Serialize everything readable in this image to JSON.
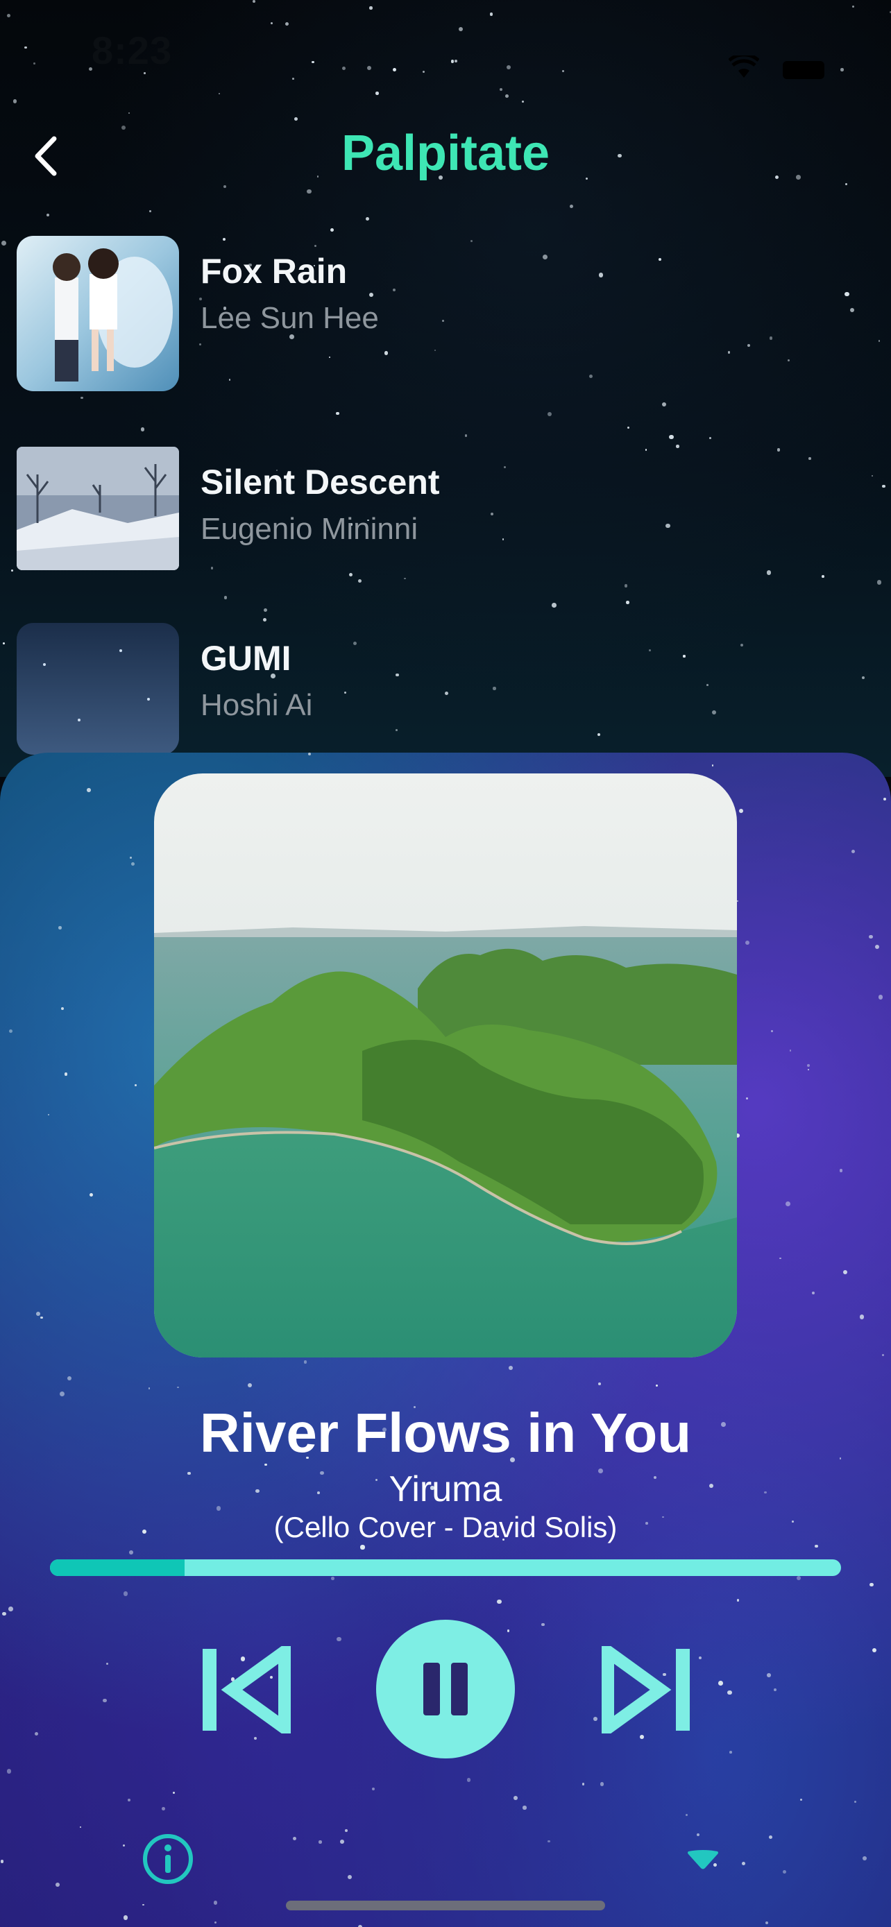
{
  "status_bar": {
    "time": "8:23"
  },
  "header": {
    "title": "Palpitate",
    "back_icon": "chevron-left-icon"
  },
  "tracks": [
    {
      "name": "Fox Rain",
      "artist": "Lee Sun Hee"
    },
    {
      "name": "Silent Descent",
      "artist": "Eugenio Mininni"
    },
    {
      "name": "GUMI",
      "artist": "Hoshi Ai"
    }
  ],
  "player": {
    "song_title": "River Flows in You",
    "artist": "Yiruma",
    "subtitle": "(Cello Cover - David Solis)",
    "progress_fraction": 0.17,
    "controls": {
      "prev_icon": "skip-previous-icon",
      "play_pause_icon": "pause-icon",
      "next_icon": "skip-next-icon"
    },
    "info_icon": "info-icon",
    "collapse_icon": "chevron-down-icon"
  },
  "colors": {
    "accent": "#3ee6b4",
    "control": "#7eeee4",
    "progress_fill": "#0fc6b6",
    "progress_track": "#72ede3"
  }
}
